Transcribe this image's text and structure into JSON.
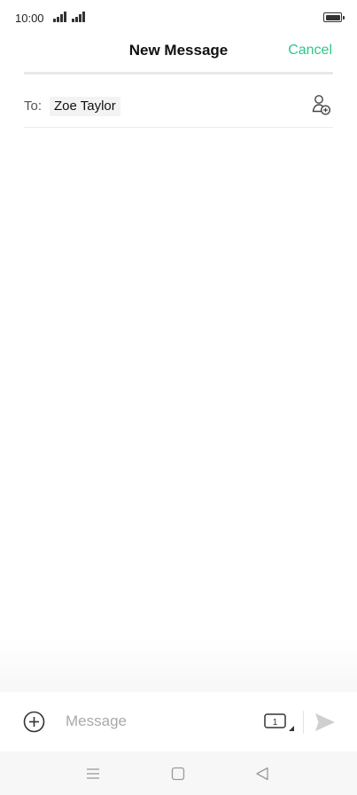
{
  "status_bar": {
    "time": "10:00"
  },
  "header": {
    "title": "New Message",
    "cancel_label": "Cancel"
  },
  "recipient": {
    "to_label": "To:",
    "name": "Zoe Taylor"
  },
  "compose": {
    "placeholder": "Message",
    "sim_slot": "1"
  },
  "colors": {
    "accent": "#2fc58c",
    "placeholder": "#a9a9a9",
    "nav_background": "#f7f7f7"
  },
  "icons": {
    "add_contact": "add-contact-icon",
    "add_attachment": "plus-circle-icon",
    "sim_selector": "sim-card-icon",
    "send": "send-icon",
    "nav_menu": "menu-icon",
    "nav_home": "home-icon",
    "nav_back": "back-icon"
  }
}
